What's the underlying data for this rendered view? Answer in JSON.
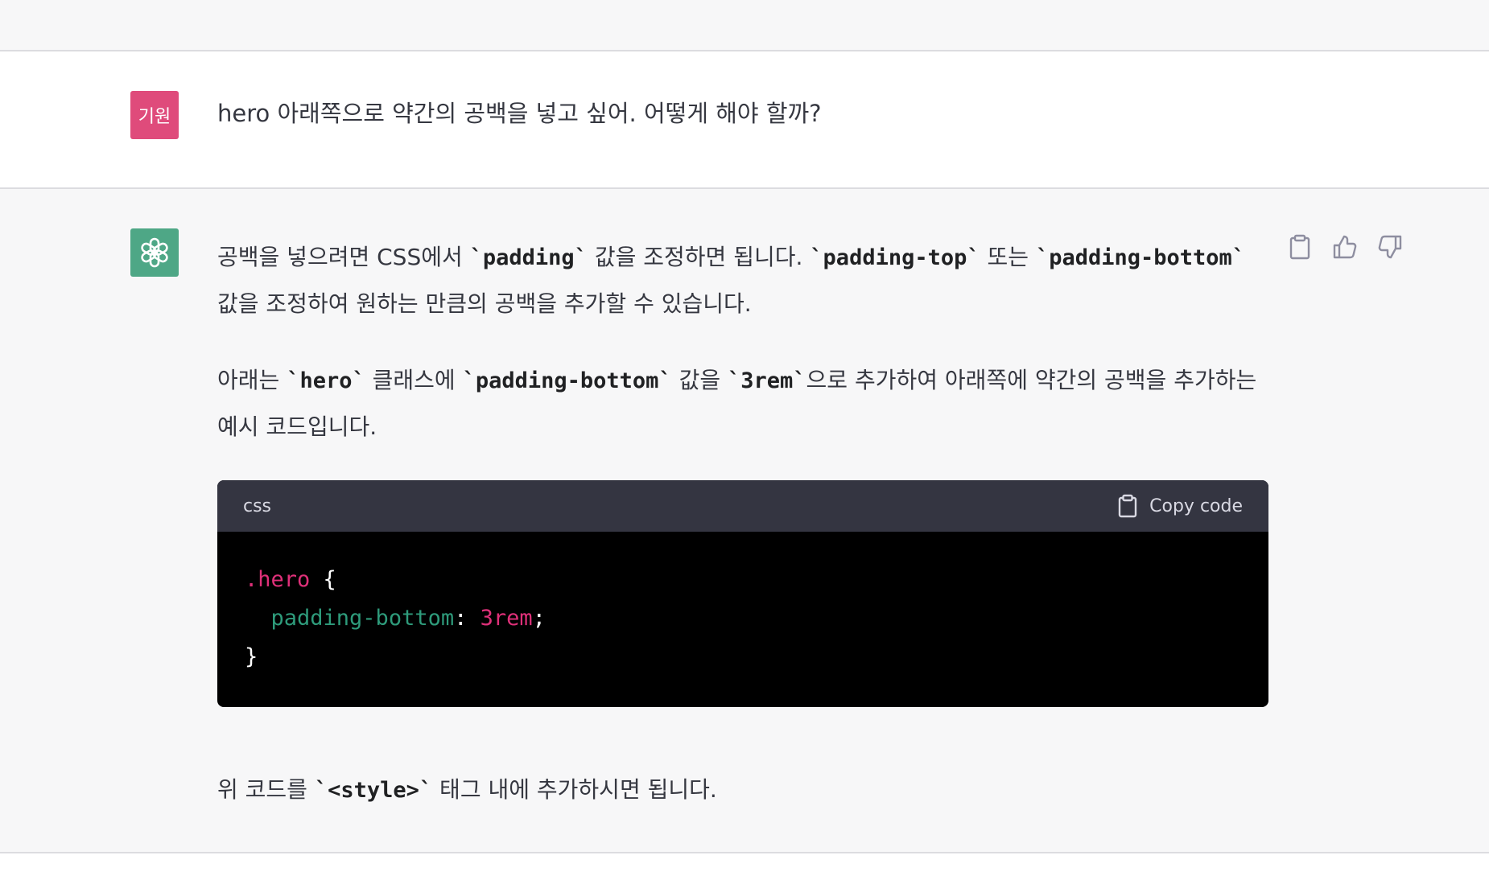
{
  "user": {
    "avatar_label": "기원",
    "message": "hero 아래쪽으로 약간의 공백을 넣고 싶어. 어떻게 해야 할까?"
  },
  "assistant": {
    "p1": {
      "t1": "공백을 넣으려면 CSS에서 ",
      "c1": "`padding`",
      "t2": " 값을 조정하면 됩니다. ",
      "c2": "`padding-top`",
      "t3": " 또는 ",
      "c3": "`padding-bottom`",
      "t4": " 값을 조정하여 원하는 만큼의 공백을 추가할 수 있습니다."
    },
    "p2": {
      "t1": "아래는 ",
      "c1": "`hero`",
      "t2": " 클래스에 ",
      "c2": "`padding-bottom`",
      "t3": " 값을 ",
      "c3": "`3rem`",
      "t4": "으로 추가하여 아래쪽에 약간의 공백을 추가하는 예시 코드입니다."
    },
    "code": {
      "language": "css",
      "copy_label": "Copy code",
      "selector": ".hero",
      "open_brace": " {",
      "property": "padding-bottom",
      "colon": ": ",
      "value": "3rem",
      "semicolon": ";",
      "close_brace": "}"
    },
    "p3": {
      "t1": "위 코드를 ",
      "c1": "`<style>`",
      "t2": " 태그 내에 추가하시면 됩니다."
    }
  },
  "icons": {
    "assistant_logo": "openai-logo-icon",
    "copy": "clipboard-icon",
    "like": "thumbs-up-icon",
    "dislike": "thumbs-down-icon"
  },
  "colors": {
    "user_avatar": "#df4b7b",
    "assistant_avatar": "#4ea786",
    "code_header": "#343541",
    "code_bg": "#000000",
    "selector": "#df3079",
    "property": "#2e9b7b"
  }
}
